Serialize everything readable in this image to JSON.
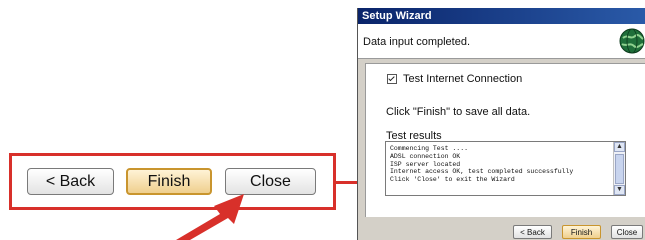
{
  "zoomed_buttons": {
    "back_label": "< Back",
    "finish_label": "Finish",
    "close_label": "Close"
  },
  "wizard": {
    "title": "Setup Wizard",
    "header_text": "Data input completed.",
    "checkbox_label": "Test Internet Connection",
    "checkbox_checked": true,
    "save_note": "Click \"Finish\" to save all data.",
    "results_label": "Test results",
    "results_lines": [
      "Commencing Test ....",
      "ADSL connection OK",
      "ISP server located",
      "Internet access OK, test completed successfully",
      "Click 'Close' to exit the Wizard"
    ],
    "buttons": {
      "back_label": "< Back",
      "finish_label": "Finish",
      "close_label": "Close"
    }
  },
  "colors": {
    "annotation_red": "#d8302a",
    "title_bar": "#0a246a",
    "finish_highlight": "#efcf8e"
  },
  "icons": {
    "header_icon": "globe-icon",
    "pointer": "arrow-icon"
  }
}
